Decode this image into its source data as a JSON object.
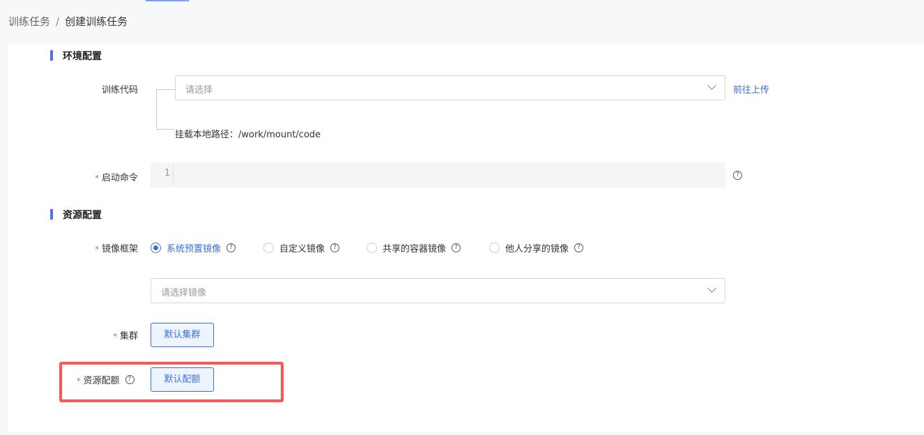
{
  "breadcrumb": {
    "parent": "训练任务",
    "separator": "/",
    "current": "创建训练任务"
  },
  "env": {
    "title": "环境配置",
    "code_label": "训练代码",
    "code_placeholder": "请选择",
    "upload_link": "前往上传",
    "mount_path": "挂载本地路径：/work/mount/code",
    "cmd_label": "启动命令",
    "line_no": "1"
  },
  "res": {
    "title": "资源配置",
    "image_label": "镜像框架",
    "radios": [
      {
        "label": "系统预置镜像",
        "selected": true
      },
      {
        "label": "自定义镜像",
        "selected": false
      },
      {
        "label": "共享的容器镜像",
        "selected": false
      },
      {
        "label": "他人分享的镜像",
        "selected": false
      }
    ],
    "image_placeholder": "请选择镜像",
    "cluster_label": "集群",
    "cluster_button": "默认集群",
    "quota_label": "资源配额",
    "quota_button": "默认配额"
  },
  "required_mark": "*",
  "help_glyph": "?"
}
